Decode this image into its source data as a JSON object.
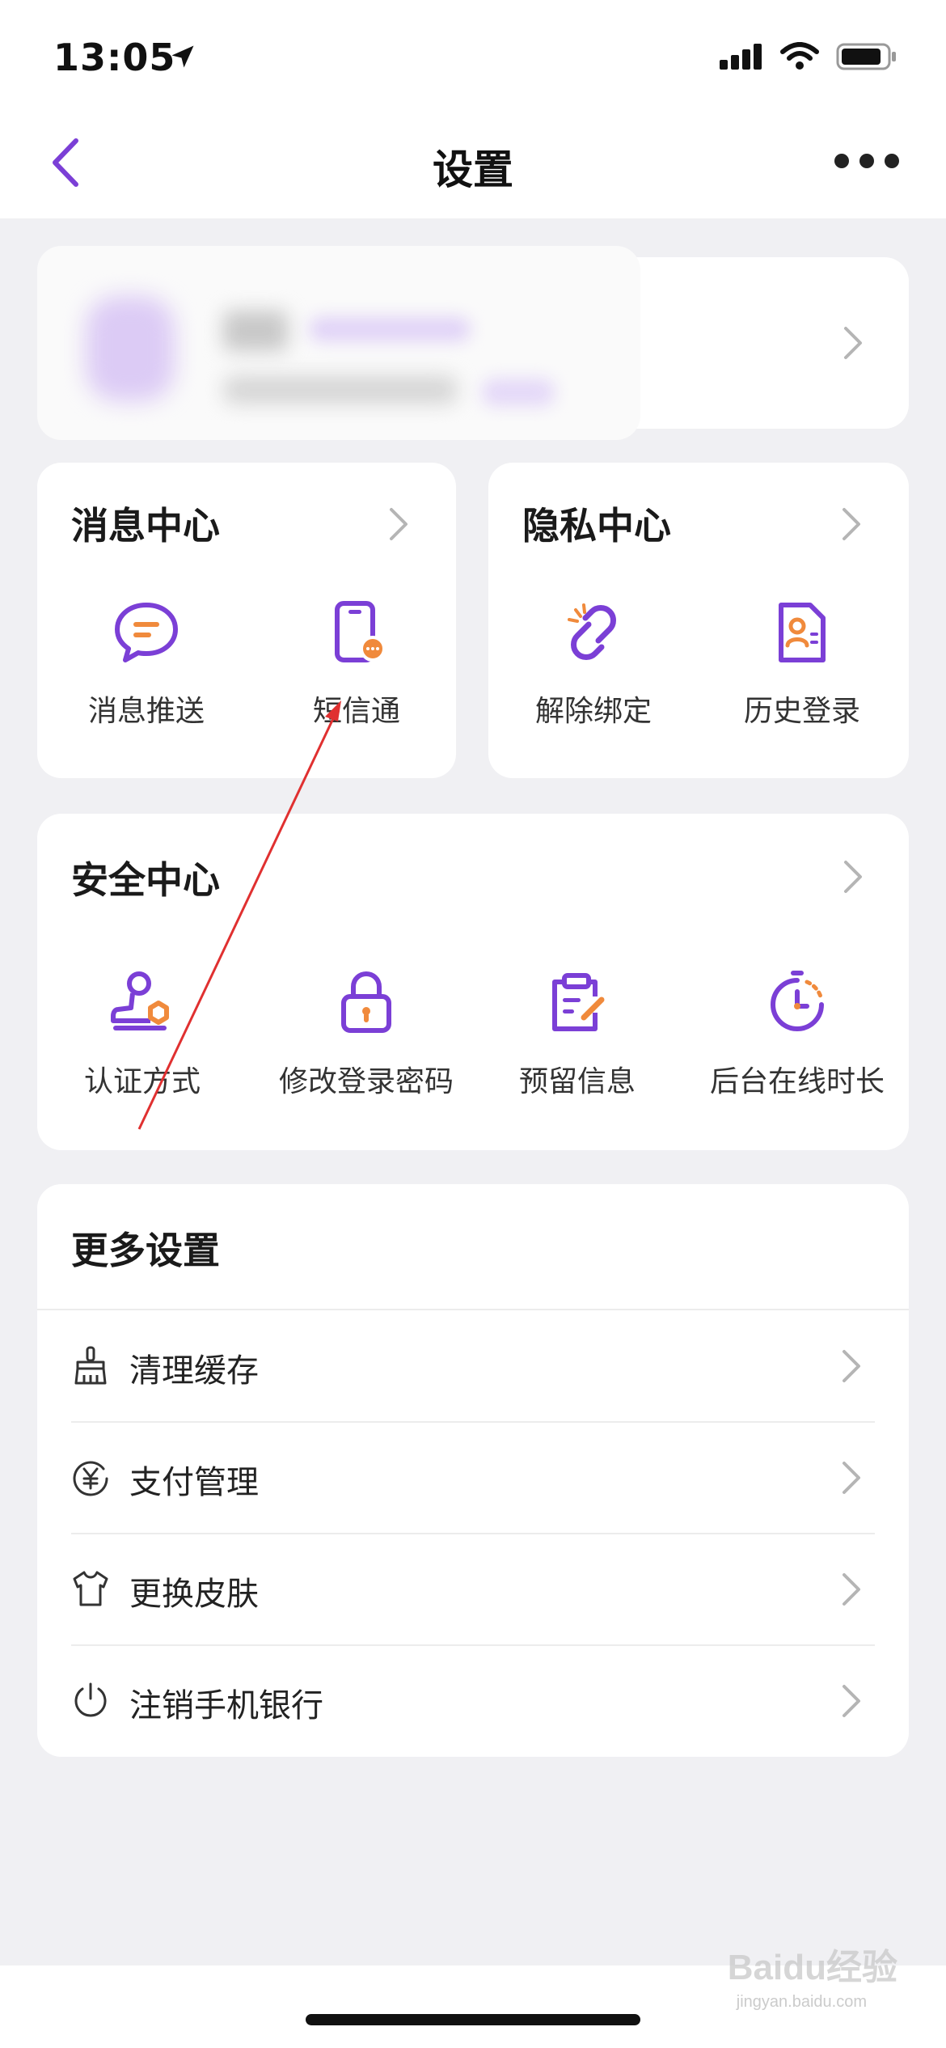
{
  "status_bar": {
    "time": "13:05"
  },
  "header": {
    "title": "设置"
  },
  "message_center": {
    "title": "消息中心",
    "items": [
      {
        "label": "消息推送",
        "icon": "message-push-icon"
      },
      {
        "label": "短信通",
        "icon": "sms-phone-icon"
      }
    ]
  },
  "privacy_center": {
    "title": "隐私中心",
    "items": [
      {
        "label": "解除绑定",
        "icon": "unlink-icon"
      },
      {
        "label": "历史登录",
        "icon": "login-history-icon"
      }
    ]
  },
  "security_center": {
    "title": "安全中心",
    "items": [
      {
        "label": "认证方式",
        "icon": "stamp-icon"
      },
      {
        "label": "修改登录密码",
        "icon": "lock-icon"
      },
      {
        "label": "预留信息",
        "icon": "edit-note-icon"
      },
      {
        "label": "后台在线时长",
        "icon": "stopwatch-icon"
      }
    ]
  },
  "more_settings": {
    "title": "更多设置",
    "items": [
      {
        "label": "清理缓存",
        "icon": "broom-icon"
      },
      {
        "label": "支付管理",
        "icon": "yen-icon"
      },
      {
        "label": "更换皮肤",
        "icon": "shirt-icon"
      },
      {
        "label": "注销手机银行",
        "icon": "power-icon"
      }
    ]
  },
  "watermark": {
    "text": "Baidu经验",
    "sub": "jingyan.baidu.com"
  },
  "colors": {
    "accent": "#7b3fd6",
    "accent_orange": "#f08a3c",
    "background": "#f0f0f3"
  }
}
